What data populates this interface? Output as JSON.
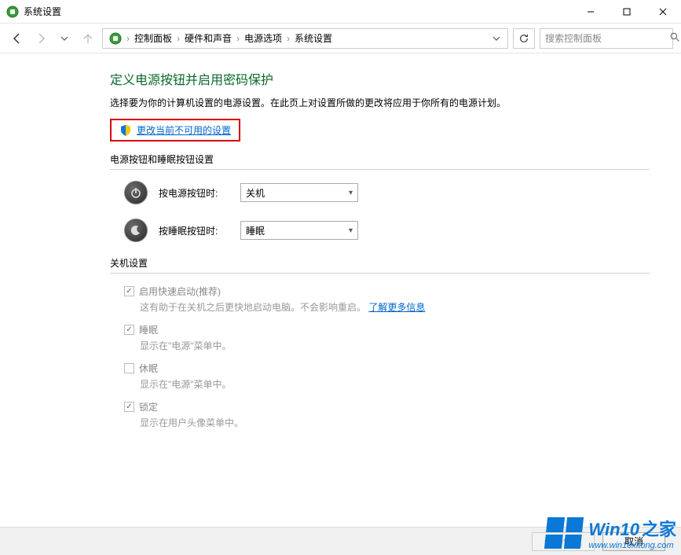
{
  "window": {
    "title": "系统设置"
  },
  "breadcrumb": {
    "items": [
      "控制面板",
      "硬件和声音",
      "电源选项",
      "系统设置"
    ]
  },
  "search": {
    "placeholder": "搜索控制面板"
  },
  "main": {
    "title": "定义电源按钮并启用密码保护",
    "desc": "选择要为你的计算机设置的电源设置。在此页上对设置所做的更改将应用于你所有的电源计划。",
    "admin_link": "更改当前不可用的设置",
    "section_buttons_title": "电源按钮和睡眠按钮设置",
    "power_button": {
      "label": "按电源按钮时:",
      "value": "关机"
    },
    "sleep_button": {
      "label": "按睡眠按钮时:",
      "value": "睡眠"
    },
    "section_shutdown_title": "关机设置",
    "options": [
      {
        "checked": true,
        "label": "启用快速启动(推荐)",
        "desc_prefix": "这有助于在关机之后更快地启动电脑。不会影响重启。",
        "desc_link": "了解更多信息"
      },
      {
        "checked": true,
        "label": "睡眠",
        "desc": "显示在\"电源\"菜单中。"
      },
      {
        "checked": false,
        "label": "休眠",
        "desc": "显示在\"电源\"菜单中。"
      },
      {
        "checked": true,
        "label": "锁定",
        "desc": "显示在用户头像菜单中。"
      }
    ]
  },
  "footer": {
    "save": "保存修改",
    "cancel": "取消"
  },
  "watermark": {
    "brand_prefix": "Win10",
    "brand_suffix": "之家",
    "url": "www.win10xitong.com"
  }
}
